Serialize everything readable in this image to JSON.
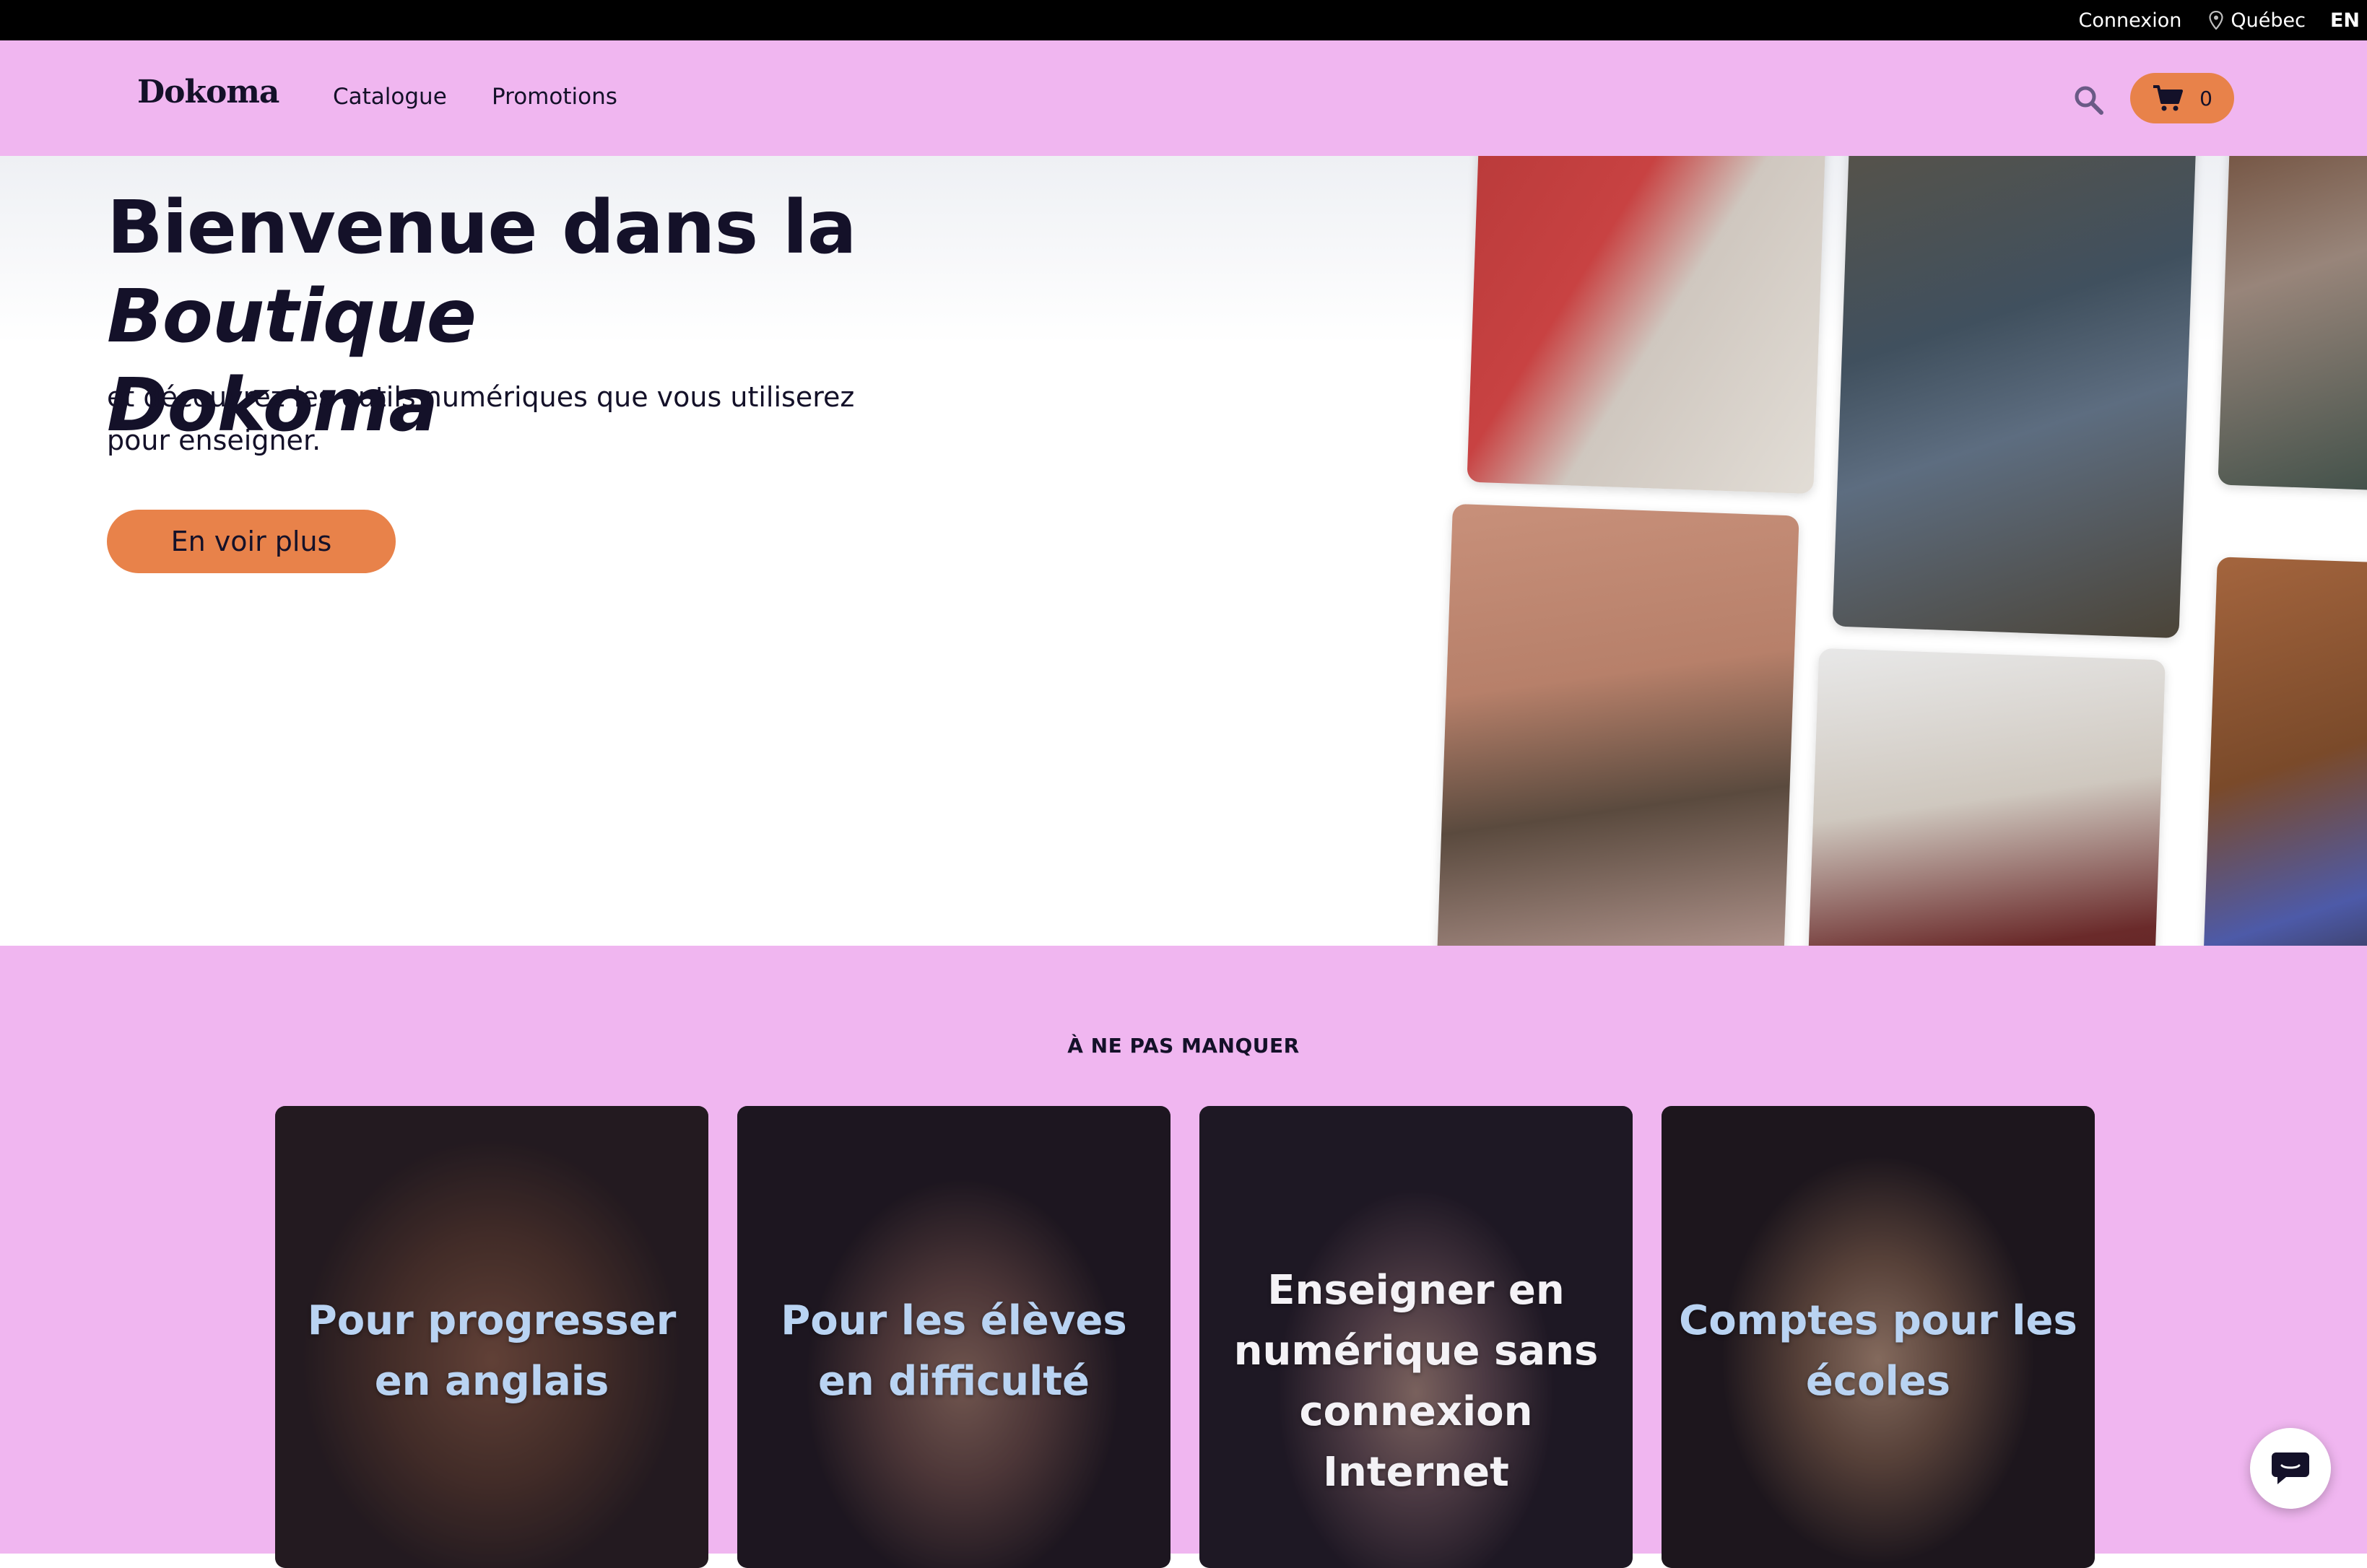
{
  "topbar": {
    "login": "Connexion",
    "location": "Québec",
    "language": "EN"
  },
  "navbar": {
    "logo": "Dokoma",
    "links": [
      "Catalogue",
      "Promotions"
    ],
    "cart_count": "0",
    "icons": [
      "search-icon",
      "cart-icon"
    ]
  },
  "hero": {
    "title_plain": "Bienvenue dans la ",
    "title_italic_1": "Boutique",
    "title_italic_2": "Dokoma",
    "subtitle": "et découvrez les outils numériques que vous utiliserez pour enseigner.",
    "cta": "En voir plus"
  },
  "featured": {
    "label": "À NE PAS MANQUER",
    "cards": [
      {
        "title": "Pour progresser en anglais"
      },
      {
        "title": "Pour les élèves en difficulté"
      },
      {
        "title": "Enseigner en numérique sans connexion Internet"
      },
      {
        "title": "Comptes pour les écoles"
      }
    ]
  },
  "colors": {
    "nav_background": "#f0b6f0",
    "accent_orange": "#e8824a",
    "text_dark": "#141129",
    "card_title": "#b9d3f2"
  }
}
